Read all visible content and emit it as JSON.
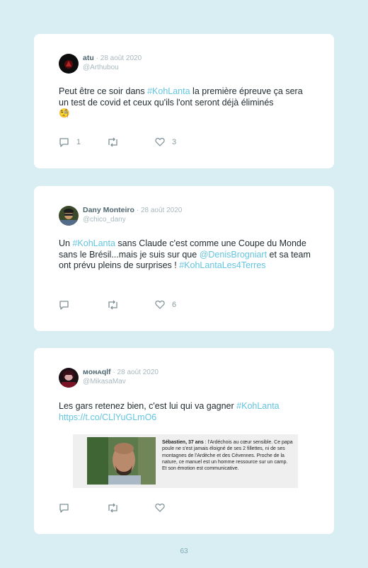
{
  "tweets": [
    {
      "name": "atu",
      "date": "· 28 août 2020",
      "handle": "@Arthubou",
      "text_pre": "Peut être ce soir dans ",
      "hashtag": "#KohLanta",
      "text_post": " la première épreuve ça sera un test de covid et ceux qu'ils l'ont seront déjà éliminés",
      "emoji": "🧐",
      "replies": "1",
      "retweets": "",
      "likes": "3"
    },
    {
      "name": "Dany Monteiro",
      "date": "· 28 août 2020",
      "handle": "@chico_dany",
      "text_pre": "Un ",
      "hashtag": "#KohLanta",
      "text_mid": " sans Claude c'est comme une Coupe du Monde sans le Brésil...mais je suis sur que ",
      "mention": "@DenisBrogniart",
      "text_post": " et sa team ont prévu pleins de surprises ! ",
      "hashtag2": "#KohLantaLes4Terres",
      "replies": "",
      "retweets": "",
      "likes": "6"
    },
    {
      "name": "ᴍᴏʜᴀqlf",
      "date": "· 28 août 2020",
      "handle": "@MikasaMav",
      "text_pre": "Les gars retenez bien, c'est lui qui va gagner ",
      "hashtag": "#KohLanta",
      "link": "https://t.co/CLlYuGLmO6",
      "media_name": "Sébastien, 37 ans",
      "media_text": " : l'Ardéchois au cœur sensible. Ce papa poule ne s'est jamais éloigné de ses 2 fillettes, ni de ses montagnes de l'Ardèche et des Cévennes. Proche de la nature, ce manuel est un homme ressource sur un camp. Et son émotion est communicative.",
      "replies": "",
      "retweets": "",
      "likes": ""
    }
  ],
  "page_number": "63",
  "colors": {
    "background": "#d9eef3",
    "card": "#ffffff",
    "link": "#63c5e0",
    "name": "#4d6670",
    "muted": "#a9b9bf"
  },
  "icons": [
    "reply-icon",
    "retweet-icon",
    "like-icon"
  ]
}
